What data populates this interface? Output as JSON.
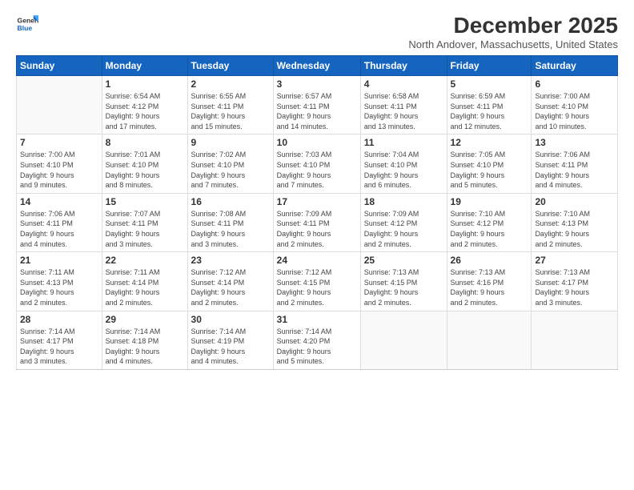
{
  "logo": {
    "line1": "General",
    "line2": "Blue"
  },
  "title": "December 2025",
  "location": "North Andover, Massachusetts, United States",
  "days_header": [
    "Sunday",
    "Monday",
    "Tuesday",
    "Wednesday",
    "Thursday",
    "Friday",
    "Saturday"
  ],
  "weeks": [
    [
      {
        "day": "",
        "info": ""
      },
      {
        "day": "1",
        "info": "Sunrise: 6:54 AM\nSunset: 4:12 PM\nDaylight: 9 hours\nand 17 minutes."
      },
      {
        "day": "2",
        "info": "Sunrise: 6:55 AM\nSunset: 4:11 PM\nDaylight: 9 hours\nand 15 minutes."
      },
      {
        "day": "3",
        "info": "Sunrise: 6:57 AM\nSunset: 4:11 PM\nDaylight: 9 hours\nand 14 minutes."
      },
      {
        "day": "4",
        "info": "Sunrise: 6:58 AM\nSunset: 4:11 PM\nDaylight: 9 hours\nand 13 minutes."
      },
      {
        "day": "5",
        "info": "Sunrise: 6:59 AM\nSunset: 4:11 PM\nDaylight: 9 hours\nand 12 minutes."
      },
      {
        "day": "6",
        "info": "Sunrise: 7:00 AM\nSunset: 4:10 PM\nDaylight: 9 hours\nand 10 minutes."
      }
    ],
    [
      {
        "day": "7",
        "info": "Sunrise: 7:00 AM\nSunset: 4:10 PM\nDaylight: 9 hours\nand 9 minutes."
      },
      {
        "day": "8",
        "info": "Sunrise: 7:01 AM\nSunset: 4:10 PM\nDaylight: 9 hours\nand 8 minutes."
      },
      {
        "day": "9",
        "info": "Sunrise: 7:02 AM\nSunset: 4:10 PM\nDaylight: 9 hours\nand 7 minutes."
      },
      {
        "day": "10",
        "info": "Sunrise: 7:03 AM\nSunset: 4:10 PM\nDaylight: 9 hours\nand 7 minutes."
      },
      {
        "day": "11",
        "info": "Sunrise: 7:04 AM\nSunset: 4:10 PM\nDaylight: 9 hours\nand 6 minutes."
      },
      {
        "day": "12",
        "info": "Sunrise: 7:05 AM\nSunset: 4:10 PM\nDaylight: 9 hours\nand 5 minutes."
      },
      {
        "day": "13",
        "info": "Sunrise: 7:06 AM\nSunset: 4:11 PM\nDaylight: 9 hours\nand 4 minutes."
      }
    ],
    [
      {
        "day": "14",
        "info": "Sunrise: 7:06 AM\nSunset: 4:11 PM\nDaylight: 9 hours\nand 4 minutes."
      },
      {
        "day": "15",
        "info": "Sunrise: 7:07 AM\nSunset: 4:11 PM\nDaylight: 9 hours\nand 3 minutes."
      },
      {
        "day": "16",
        "info": "Sunrise: 7:08 AM\nSunset: 4:11 PM\nDaylight: 9 hours\nand 3 minutes."
      },
      {
        "day": "17",
        "info": "Sunrise: 7:09 AM\nSunset: 4:11 PM\nDaylight: 9 hours\nand 2 minutes."
      },
      {
        "day": "18",
        "info": "Sunrise: 7:09 AM\nSunset: 4:12 PM\nDaylight: 9 hours\nand 2 minutes."
      },
      {
        "day": "19",
        "info": "Sunrise: 7:10 AM\nSunset: 4:12 PM\nDaylight: 9 hours\nand 2 minutes."
      },
      {
        "day": "20",
        "info": "Sunrise: 7:10 AM\nSunset: 4:13 PM\nDaylight: 9 hours\nand 2 minutes."
      }
    ],
    [
      {
        "day": "21",
        "info": "Sunrise: 7:11 AM\nSunset: 4:13 PM\nDaylight: 9 hours\nand 2 minutes."
      },
      {
        "day": "22",
        "info": "Sunrise: 7:11 AM\nSunset: 4:14 PM\nDaylight: 9 hours\nand 2 minutes."
      },
      {
        "day": "23",
        "info": "Sunrise: 7:12 AM\nSunset: 4:14 PM\nDaylight: 9 hours\nand 2 minutes."
      },
      {
        "day": "24",
        "info": "Sunrise: 7:12 AM\nSunset: 4:15 PM\nDaylight: 9 hours\nand 2 minutes."
      },
      {
        "day": "25",
        "info": "Sunrise: 7:13 AM\nSunset: 4:15 PM\nDaylight: 9 hours\nand 2 minutes."
      },
      {
        "day": "26",
        "info": "Sunrise: 7:13 AM\nSunset: 4:16 PM\nDaylight: 9 hours\nand 2 minutes."
      },
      {
        "day": "27",
        "info": "Sunrise: 7:13 AM\nSunset: 4:17 PM\nDaylight: 9 hours\nand 3 minutes."
      }
    ],
    [
      {
        "day": "28",
        "info": "Sunrise: 7:14 AM\nSunset: 4:17 PM\nDaylight: 9 hours\nand 3 minutes."
      },
      {
        "day": "29",
        "info": "Sunrise: 7:14 AM\nSunset: 4:18 PM\nDaylight: 9 hours\nand 4 minutes."
      },
      {
        "day": "30",
        "info": "Sunrise: 7:14 AM\nSunset: 4:19 PM\nDaylight: 9 hours\nand 4 minutes."
      },
      {
        "day": "31",
        "info": "Sunrise: 7:14 AM\nSunset: 4:20 PM\nDaylight: 9 hours\nand 5 minutes."
      },
      {
        "day": "",
        "info": ""
      },
      {
        "day": "",
        "info": ""
      },
      {
        "day": "",
        "info": ""
      }
    ]
  ]
}
